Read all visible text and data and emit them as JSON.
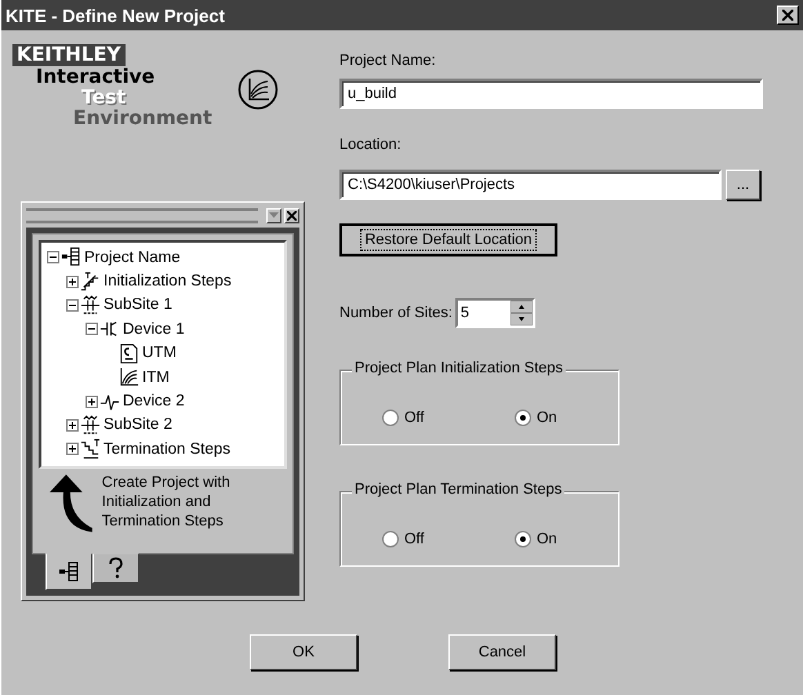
{
  "window": {
    "title": "KITE - Define New Project"
  },
  "logo": {
    "brand": "KEITHLEY",
    "lines": [
      "Interactive",
      "Test",
      "Environment"
    ]
  },
  "tree": [
    {
      "label": "Project Name",
      "kind": "project",
      "expanded": true,
      "children": [
        {
          "label": "Initialization Steps",
          "kind": "init",
          "expanded": false
        },
        {
          "label": "SubSite 1",
          "kind": "subsite",
          "expanded": true,
          "children": [
            {
              "label": "Device 1",
              "kind": "device",
              "expanded": true,
              "children": [
                {
                  "label": "UTM",
                  "kind": "utm"
                },
                {
                  "label": "ITM",
                  "kind": "itm"
                }
              ]
            },
            {
              "label": "Device 2",
              "kind": "device2",
              "expanded": false
            }
          ]
        },
        {
          "label": "SubSite 2",
          "kind": "subsite",
          "expanded": false
        },
        {
          "label": "Termination Steps",
          "kind": "term",
          "expanded": false
        }
      ]
    }
  ],
  "hint": "Create Project with Initialization and Termination Steps",
  "panel_tabs": [
    {
      "kind": "tree",
      "selected": true
    },
    {
      "kind": "help",
      "selected": false
    }
  ],
  "project_name": {
    "label": "Project Name:",
    "value": "u_build"
  },
  "location": {
    "label": "Location:",
    "value": "C:\\S4200\\kiuser\\Projects",
    "browse": "..."
  },
  "restore_button": {
    "label": "Restore Default Location"
  },
  "sites": {
    "label": "Number of Sites:",
    "value": "5"
  },
  "groups": [
    {
      "title": "Project Plan Initialization Steps",
      "options": [
        {
          "label": "Off",
          "selected": false
        },
        {
          "label": "On",
          "selected": true
        }
      ]
    },
    {
      "title": "Project Plan Termination Steps",
      "options": [
        {
          "label": "Off",
          "selected": false
        },
        {
          "label": "On",
          "selected": true
        }
      ]
    }
  ],
  "buttons": [
    {
      "label": "OK"
    },
    {
      "label": "Cancel"
    }
  ]
}
